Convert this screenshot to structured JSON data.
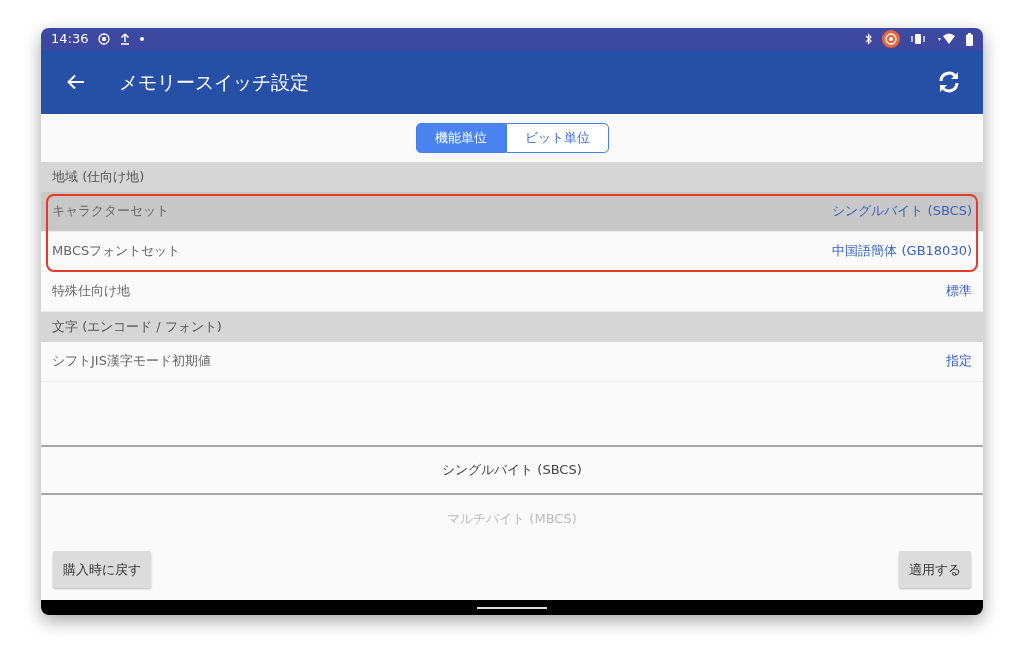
{
  "status_bar": {
    "time": "14:36"
  },
  "app_bar": {
    "title": "メモリースイッチ設定"
  },
  "segments": [
    {
      "label": "機能単位",
      "selected": true
    },
    {
      "label": "ビット単位",
      "selected": false
    }
  ],
  "sections": [
    {
      "header": "地域 (仕向け地)",
      "rows": [
        {
          "label": "キャラクターセット",
          "value": "シングルバイト (SBCS)",
          "selected": true,
          "highlighted": true
        },
        {
          "label": "MBCSフォントセット",
          "value": "中国語簡体 (GB18030)",
          "selected": false,
          "highlighted": true
        },
        {
          "label": "特殊仕向け地",
          "value": "標準",
          "selected": false,
          "highlighted": false
        }
      ]
    },
    {
      "header": "文字 (エンコード / フォント)",
      "rows": [
        {
          "label": "シフトJIS漢字モード初期値",
          "value": "指定",
          "selected": false,
          "highlighted": false
        }
      ]
    }
  ],
  "picker": [
    {
      "label": "シングルバイト (SBCS)",
      "selected": true
    },
    {
      "label": "マルチバイト (MBCS)",
      "selected": false
    }
  ],
  "buttons": [
    {
      "label": "購入時に戻す"
    },
    {
      "label": "適用する"
    }
  ]
}
